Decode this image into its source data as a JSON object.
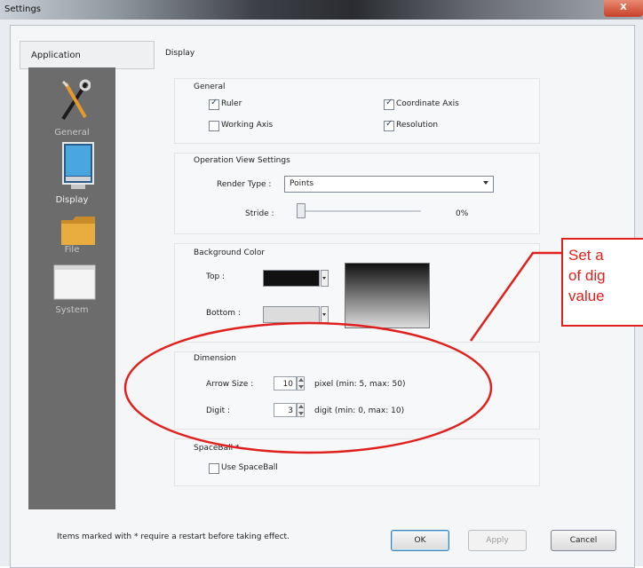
{
  "window": {
    "title": "Settings",
    "close_glyph": "X"
  },
  "nav": {
    "header": "Application",
    "items": [
      {
        "label": "General",
        "icon": "tools-icon"
      },
      {
        "label": "Display",
        "icon": "monitor-icon"
      },
      {
        "label": "File",
        "icon": "folder-icon"
      },
      {
        "label": "System",
        "icon": "window-icon"
      }
    ],
    "active": "Display"
  },
  "display": {
    "title": "Display",
    "general": {
      "title": "General",
      "ruler": {
        "label": "Ruler",
        "checked": true
      },
      "coordinate_axis": {
        "label": "Coordinate Axis",
        "checked": true
      },
      "working_axis": {
        "label": "Working Axis",
        "checked": false
      },
      "resolution": {
        "label": "Resolution",
        "checked": true
      }
    },
    "operation": {
      "title": "Operation View Settings",
      "render_type_label": "Render Type :",
      "render_type_value": "Points",
      "stride_label": "Stride :",
      "stride_value": "0%",
      "stride_fraction": 0
    },
    "background": {
      "title": "Background Color",
      "top_label": "Top :",
      "bottom_label": "Bottom :",
      "top_color": "#111111",
      "bottom_color": "#dcdcdc"
    },
    "dimension": {
      "title": "Dimension",
      "arrow_label": "Arrow Size :",
      "arrow_value": "10",
      "arrow_hint": "pixel (min: 5, max: 50)",
      "digit_label": "Digit :",
      "digit_value": "3",
      "digit_hint": "digit (min: 0, max: 10)"
    },
    "spaceball": {
      "title": "SpaceBall *",
      "use_label": "Use SpaceBall",
      "checked": false
    }
  },
  "footer": {
    "note": "Items marked with * require a restart before taking effect.",
    "ok": "OK",
    "apply": "Apply",
    "cancel": "Cancel"
  },
  "annotation": {
    "lines": [
      "Set a",
      "of dig",
      "value"
    ],
    "color": "#e0201c"
  }
}
